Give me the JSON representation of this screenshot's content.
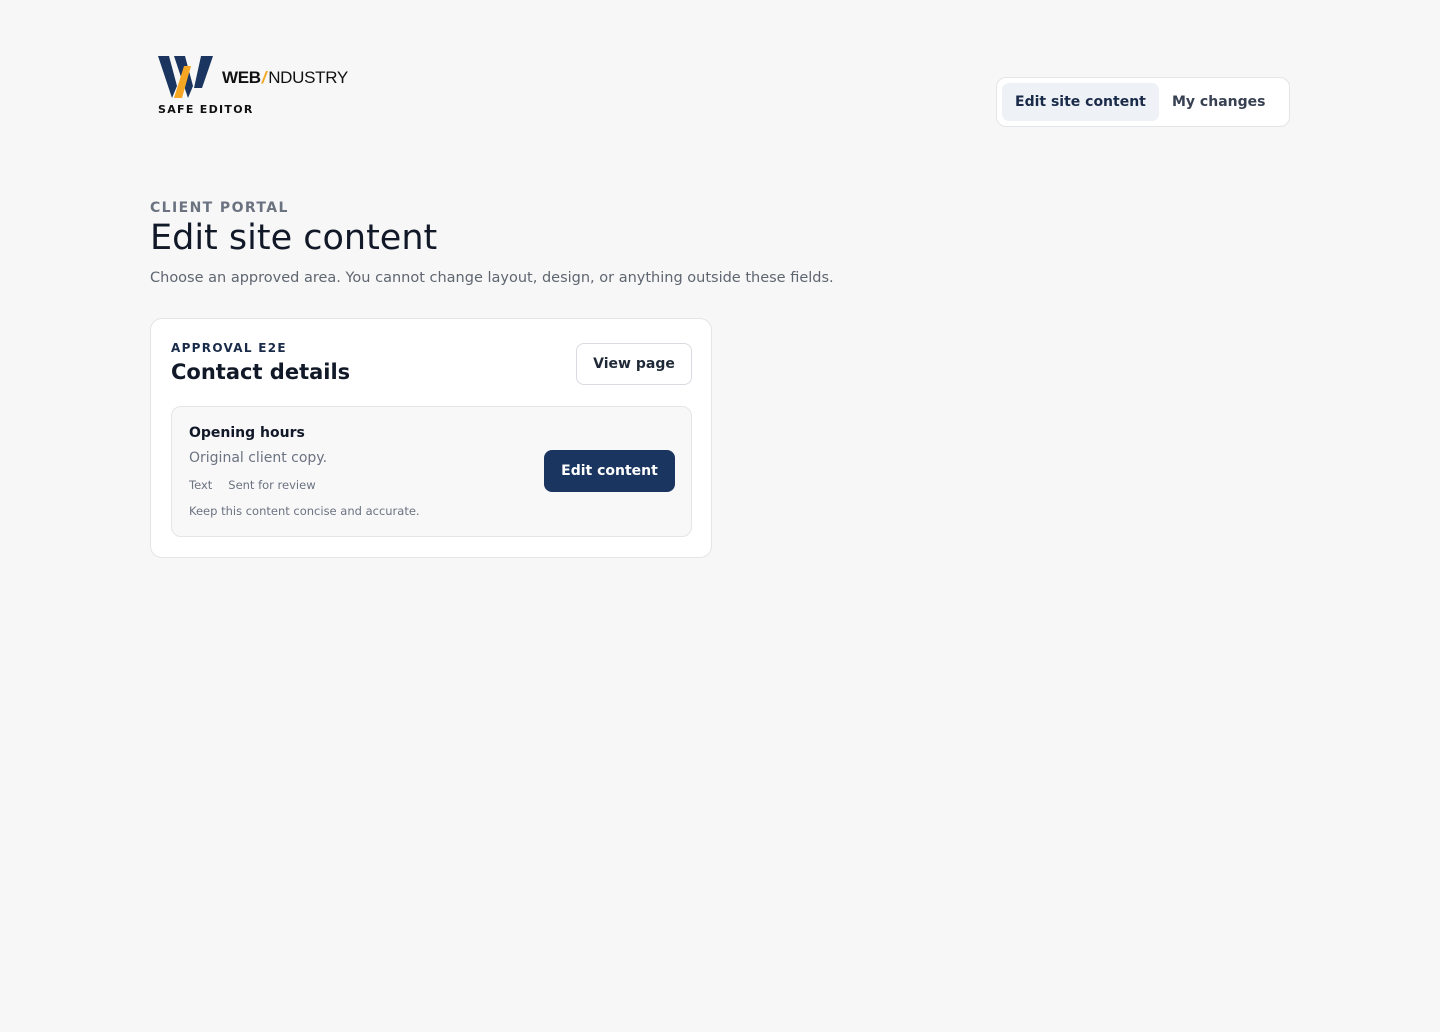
{
  "brand": {
    "word_web": "WEB",
    "word_slash": "/",
    "word_industry": "NDUSTRY",
    "subtitle": "SAFE EDITOR",
    "colors": {
      "navy": "#1a355f",
      "amber": "#f5a623"
    }
  },
  "nav": {
    "tabs": [
      {
        "label": "Edit site content",
        "active": true
      },
      {
        "label": "My changes",
        "active": false
      }
    ]
  },
  "header": {
    "eyebrow": "CLIENT PORTAL",
    "title": "Edit site content",
    "subtitle": "Choose an approved area. You cannot change layout, design, or anything outside these fields."
  },
  "area": {
    "eyebrow": "APPROVAL E2E",
    "title": "Contact details",
    "view_button": "View page",
    "fields": [
      {
        "name": "Opening hours",
        "value": "Original client copy.",
        "type": "Text",
        "status": "Sent for review",
        "hint": "Keep this content concise and accurate.",
        "edit_button": "Edit content"
      }
    ]
  }
}
